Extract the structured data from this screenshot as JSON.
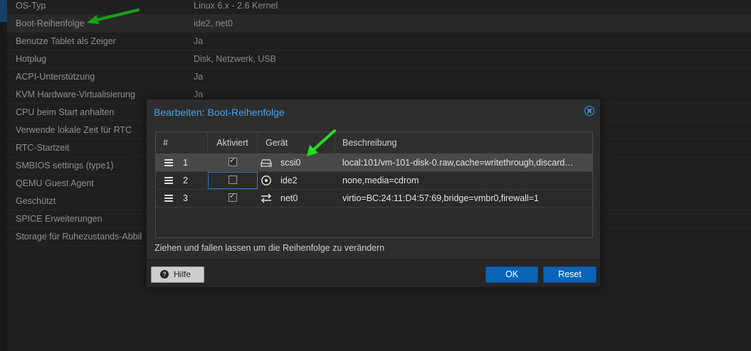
{
  "options": [
    {
      "key": "OS-Typ",
      "value": "Linux 6.x - 2.6 Kernel"
    },
    {
      "key": "Boot-Reihenfolge",
      "value": "ide2, net0",
      "selected": true
    },
    {
      "key": "Benutze Tablet als Zeiger",
      "value": "Ja"
    },
    {
      "key": "Hotplug",
      "value": "Disk, Netzwerk, USB"
    },
    {
      "key": "ACPI-Unterstützung",
      "value": "Ja"
    },
    {
      "key": "KVM Hardware-Virtualisierung",
      "value": "Ja"
    },
    {
      "key": "CPU beim Start anhalten",
      "value": ""
    },
    {
      "key": "Verwende lokale Zeit für RTC",
      "value": ""
    },
    {
      "key": "RTC-Startzeit",
      "value": ""
    },
    {
      "key": "SMBIOS settings (type1)",
      "value": ""
    },
    {
      "key": "QEMU Guest Agent",
      "value": ""
    },
    {
      "key": "Geschützt",
      "value": ""
    },
    {
      "key": "SPICE Erweiterungen",
      "value": ""
    },
    {
      "key": "Storage für Ruhezustands-Abbil",
      "value": ""
    }
  ],
  "dialog": {
    "title": "Bearbeiten: Boot-Reihenfolge",
    "columns": [
      "#",
      "Aktiviert",
      "Gerät",
      "Beschreibung"
    ],
    "rows": [
      {
        "num": "1",
        "enabled": true,
        "icon": "hdd-icon",
        "device": "scsi0",
        "description": "local:101/vm-101-disk-0.raw,cache=writethrough,discard…",
        "selected": true
      },
      {
        "num": "2",
        "enabled": false,
        "icon": "cdrom-icon",
        "device": "ide2",
        "description": "none,media=cdrom",
        "focused": true
      },
      {
        "num": "3",
        "enabled": true,
        "icon": "network-icon",
        "device": "net0",
        "description": "virtio=BC:24:11:D4:57:69,bridge=vmbr0,firewall=1"
      }
    ],
    "hint": "Ziehen und fallen lassen um die Reihenfolge zu verändern",
    "help_label": "Hilfe",
    "ok_label": "OK",
    "reset_label": "Reset"
  },
  "colors": {
    "accent": "#0a64b7",
    "title": "#4aa3e8",
    "arrow": "#22e01c"
  }
}
